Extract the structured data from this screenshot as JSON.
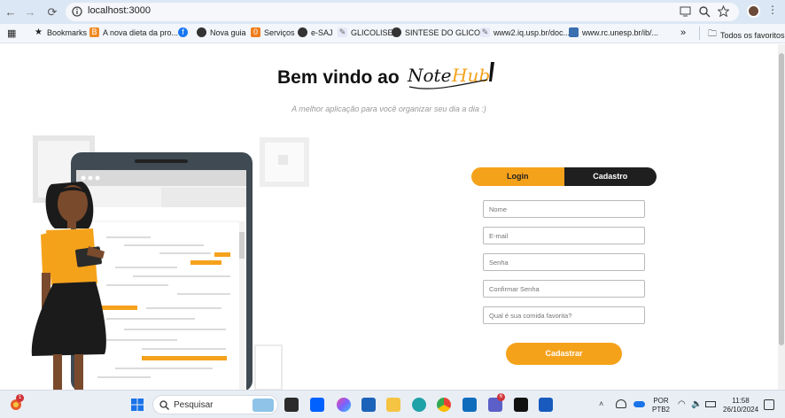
{
  "browser": {
    "url": "localhost:3000",
    "bookmarks": [
      {
        "label": "Bookmarks",
        "icon": "star-icon"
      },
      {
        "label": "A nova dieta da pro...",
        "icon": "bf-icon"
      },
      {
        "label": "",
        "icon": "facebook-icon"
      },
      {
        "label": "Nova guia",
        "icon": "globe-icon"
      },
      {
        "label": "Serviços",
        "icon": "services-icon"
      },
      {
        "label": "e-SAJ",
        "icon": "globe-icon"
      },
      {
        "label": "GLICOLISE",
        "icon": "doc-icon"
      },
      {
        "label": "SINTESE DO GLICO...",
        "icon": "globe-icon"
      },
      {
        "label": "www2.iq.usp.br/doc...",
        "icon": "doc-icon"
      },
      {
        "label": "www.rc.unesp.br/ib/...",
        "icon": "unesp-icon"
      }
    ],
    "all_bookmarks": "Todos os favoritos",
    "more": "»"
  },
  "page": {
    "title": "Bem vindo ao",
    "logo": "NoteHub",
    "subtitle": "A melhor aplicação para você organizar seu dia a dia :)",
    "tabs": {
      "login": "Login",
      "signup": "Cadastro"
    },
    "fields": {
      "name": "Nome",
      "email": "E-mail",
      "password": "Senha",
      "confirm": "Confirmar Senha",
      "question": "Qual é sua comida favorita?"
    },
    "submit": "Cadastrar"
  },
  "taskbar": {
    "search": "Pesquisar",
    "lang": "POR",
    "layout": "PTB2",
    "time": "11:58",
    "date": "26/10/2024",
    "weather_badge": "1",
    "teams_badge": "6"
  },
  "colors": {
    "accent": "#f5a21b",
    "dark": "#1f1f1f"
  }
}
